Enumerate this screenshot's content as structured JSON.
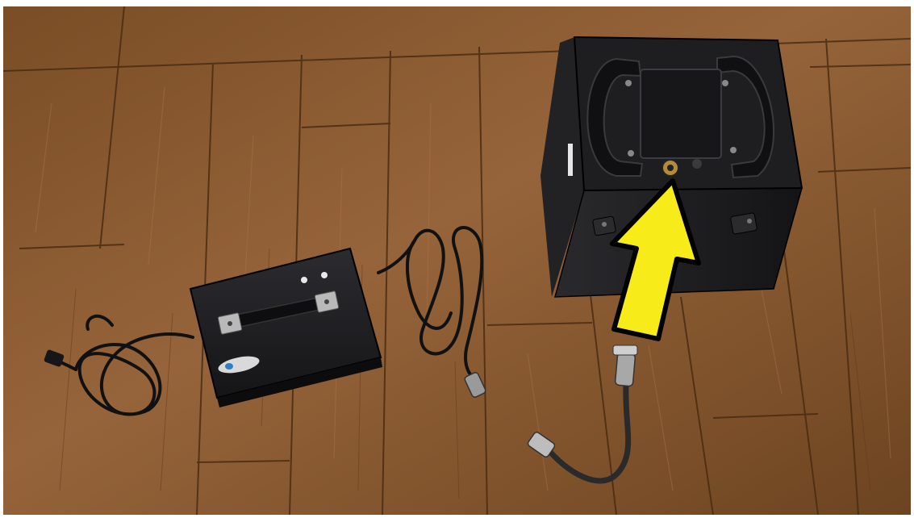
{
  "photo": {
    "scene": "",
    "charger_logo_text": "",
    "colors": {
      "floor_base": "#8a5a2e",
      "floor_dark": "#5f3a1a",
      "floor_light": "#a87644",
      "board_seam": "#4a2c12",
      "charger_body": "#1c1c1e",
      "battery_body": "#1a1a1c",
      "cable": "#111111",
      "arrow_fill": "#f7ec1a",
      "arrow_stroke": "#000000",
      "metal": "#b9b9b9",
      "background": "#ffffff"
    },
    "icons": [
      "arrow-up-left-icon"
    ]
  }
}
